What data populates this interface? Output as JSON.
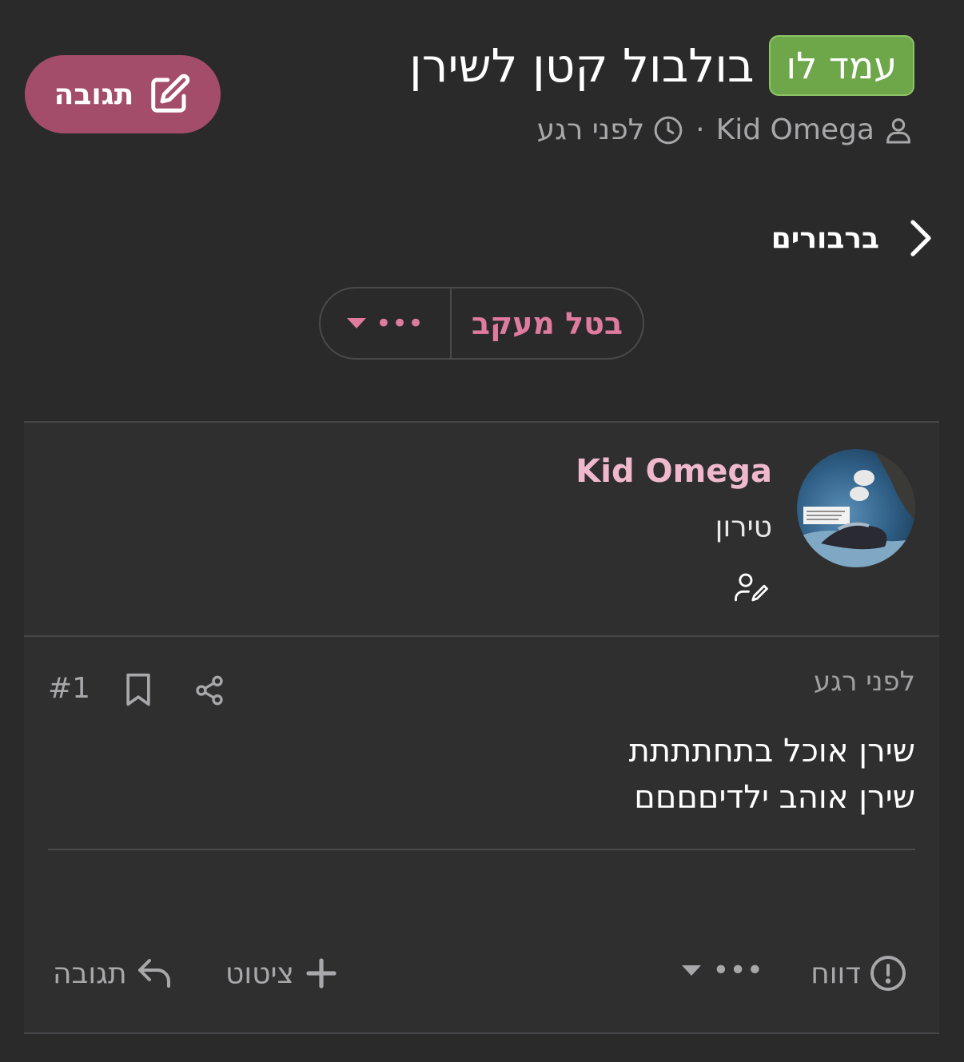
{
  "header": {
    "reply_label": "תגובה",
    "prefix": "עמד לו",
    "title": "בולבול קטן לשירן",
    "author": "Kid Omega",
    "separator": "·",
    "time": "לפני רגע"
  },
  "breadcrumb": {
    "label": "ברבורים"
  },
  "watch": {
    "unwatch_label": "בטל מעקב",
    "more_label": "•••"
  },
  "post": {
    "author_name": "Kid Omega",
    "author_rank": "טירון",
    "date": "לפני רגע",
    "number": "#1",
    "body_lines": [
      "שירן אוכל בתחתתתת",
      "שירן אוהב ילדיםםםם"
    ],
    "actions": {
      "report": "דווח",
      "more": "•••",
      "quote": "ציטוט",
      "reply": "תגובה"
    }
  },
  "colors": {
    "background": "#2a2a2b",
    "post_background": "#2f2f30",
    "accent_pink": "#e07ba0",
    "reply_button": "#a34d6a",
    "prefix_green": "#6ea64a",
    "author_name": "#f0b8cc"
  },
  "icons": {
    "reply_top": "edit-icon",
    "author_meta": "user-icon",
    "time_meta": "clock-icon",
    "breadcrumb": "chevron-right-icon",
    "more_caret": "caret-down-icon",
    "author_edit": "user-edit-icon",
    "bookmark": "bookmark-icon",
    "share": "share-icon",
    "report": "alert-circle-icon",
    "quote": "plus-icon",
    "reply": "reply-icon"
  }
}
